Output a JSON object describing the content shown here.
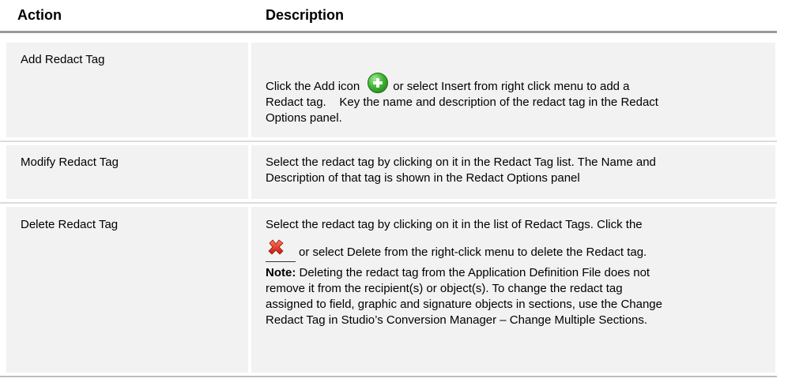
{
  "header": {
    "action": "Action",
    "description": "Description"
  },
  "rows": [
    {
      "action": "Add Redact Tag",
      "desc_part1": "Click the Add icon",
      "desc_part2": "or select Insert from right click menu to add a",
      "desc_part3": "Redact tag.    Key the name and description of the redact tag in the Redact",
      "desc_part4": "Options panel.",
      "icon": "add-icon"
    },
    {
      "action": "Modify Redact Tag",
      "desc_line1": "Select the redact tag by clicking on it in the Redact Tag list. The Name and",
      "desc_line2": "Description of that tag is shown in the Redact Options panel"
    },
    {
      "action": "Delete Redact Tag",
      "desc_line1": "Select the redact tag by clicking on it in the list of Redact Tags. Click the",
      "desc_line2": "or select Delete from the right-click menu to delete the Redact tag.",
      "icon": "delete-icon",
      "note_label": "Note:",
      "note_line1": " Deleting the redact tag from the Application Definition File does not",
      "note_line2": "remove it from the recipient(s) or object(s). To change the redact tag",
      "note_line3": "assigned to field, graphic and signature objects in sections, use the Change",
      "note_line4": "Redact Tag in Studio’s Conversion Manager – Change Multiple Sections."
    }
  ],
  "colors": {
    "cell_bg": "#f2f2f2",
    "header_rule": "#9a9a9a",
    "add_icon": "#3fb534",
    "delete_icon": "#d9261c"
  }
}
